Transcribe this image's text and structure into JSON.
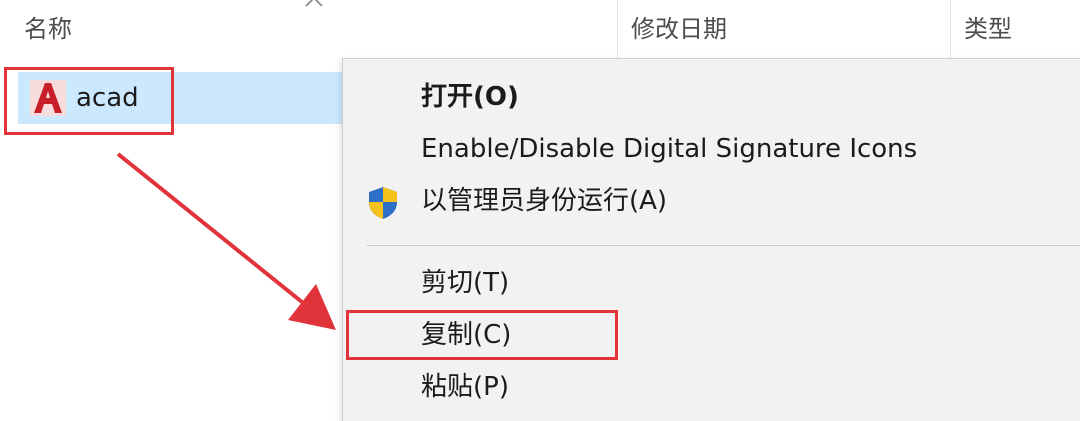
{
  "columns": {
    "name_label": "名称",
    "date_label": "修改日期",
    "type_label": "类型"
  },
  "file": {
    "name": "acad",
    "icon": "autocad-icon"
  },
  "context_menu": {
    "items": [
      {
        "label": "打开(O)",
        "bold": true
      },
      {
        "label": "Enable/Disable Digital Signature Icons"
      },
      {
        "label": "以管理员身份运行(A)",
        "icon": "uac-shield-icon"
      },
      {
        "label": "剪切(T)"
      },
      {
        "label": "复制(C)"
      },
      {
        "label": "粘贴(P)"
      }
    ]
  },
  "colors": {
    "selection": "#cce8ff",
    "menu_background": "#f2f2f2",
    "annotation": "#e0343a"
  }
}
